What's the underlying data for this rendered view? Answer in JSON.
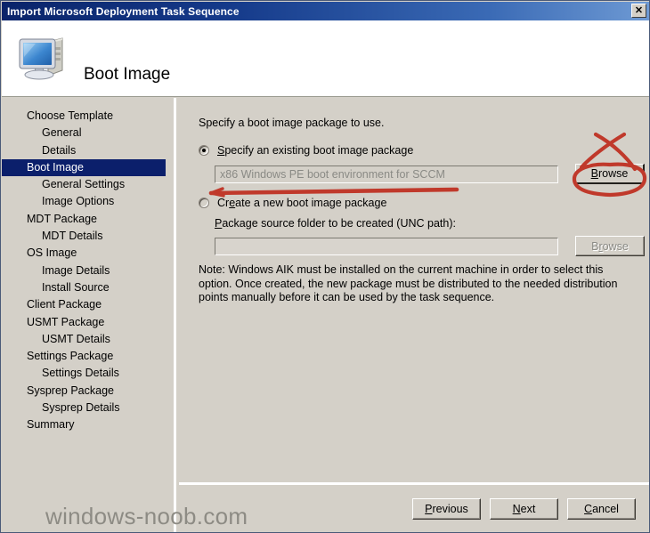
{
  "window": {
    "title": "Import Microsoft Deployment Task Sequence",
    "close_label": "✕"
  },
  "header": {
    "title": "Boot Image",
    "icon": "computer-icon"
  },
  "sidebar": {
    "items": [
      {
        "label": "Choose Template",
        "level": 0,
        "selected": false
      },
      {
        "label": "General",
        "level": 1,
        "selected": false
      },
      {
        "label": "Details",
        "level": 1,
        "selected": false
      },
      {
        "label": "Boot Image",
        "level": 0,
        "selected": true
      },
      {
        "label": "General Settings",
        "level": 1,
        "selected": false
      },
      {
        "label": "Image Options",
        "level": 1,
        "selected": false
      },
      {
        "label": "MDT Package",
        "level": 0,
        "selected": false
      },
      {
        "label": "MDT Details",
        "level": 1,
        "selected": false
      },
      {
        "label": "OS Image",
        "level": 0,
        "selected": false
      },
      {
        "label": "Image Details",
        "level": 1,
        "selected": false
      },
      {
        "label": "Install Source",
        "level": 1,
        "selected": false
      },
      {
        "label": "Client Package",
        "level": 0,
        "selected": false
      },
      {
        "label": "USMT Package",
        "level": 0,
        "selected": false
      },
      {
        "label": "USMT Details",
        "level": 1,
        "selected": false
      },
      {
        "label": "Settings Package",
        "level": 0,
        "selected": false
      },
      {
        "label": "Settings Details",
        "level": 1,
        "selected": false
      },
      {
        "label": "Sysprep Package",
        "level": 0,
        "selected": false
      },
      {
        "label": "Sysprep Details",
        "level": 1,
        "selected": false
      },
      {
        "label": "Summary",
        "level": 0,
        "selected": false
      }
    ]
  },
  "main": {
    "intro": "Specify a boot image package to use.",
    "option_existing": {
      "label": "Specify an existing boot image package",
      "accelerator": "S",
      "checked": true
    },
    "existing_field": {
      "value": "x86 Windows PE boot environment for SCCM",
      "disabled": true
    },
    "browse_existing_label": "Browse",
    "browse_existing_accelerator": "B",
    "option_create": {
      "label": "Create a new boot image package",
      "accelerator": "e",
      "checked": false
    },
    "source_label": "Package source folder to be created (UNC path):",
    "source_accelerator": "P",
    "source_field": {
      "value": "",
      "disabled": true
    },
    "browse_source_label": "Browse",
    "browse_source_accelerator": "r",
    "browse_source_disabled": true,
    "note": "Note: Windows AIK must be installed on the current machine in order to select this option.  Once created, the new package must be distributed to the needed distribution points manually before it can be used by the task sequence."
  },
  "footer": {
    "previous_label": "Previous",
    "next_label": "Next",
    "cancel_label": "Cancel"
  },
  "watermark": {
    "text": "windows-noob.com"
  },
  "annotation": {
    "color": "#c0392b",
    "circle_target": "browse-existing-button",
    "arrow_target": "existing-package-field"
  },
  "colors": {
    "titlebar_start": "#0a246a",
    "titlebar_end": "#6e9ad4",
    "face": "#d4d0c8",
    "selection": "#0b1f6b",
    "annotation_red": "#c0392b"
  }
}
